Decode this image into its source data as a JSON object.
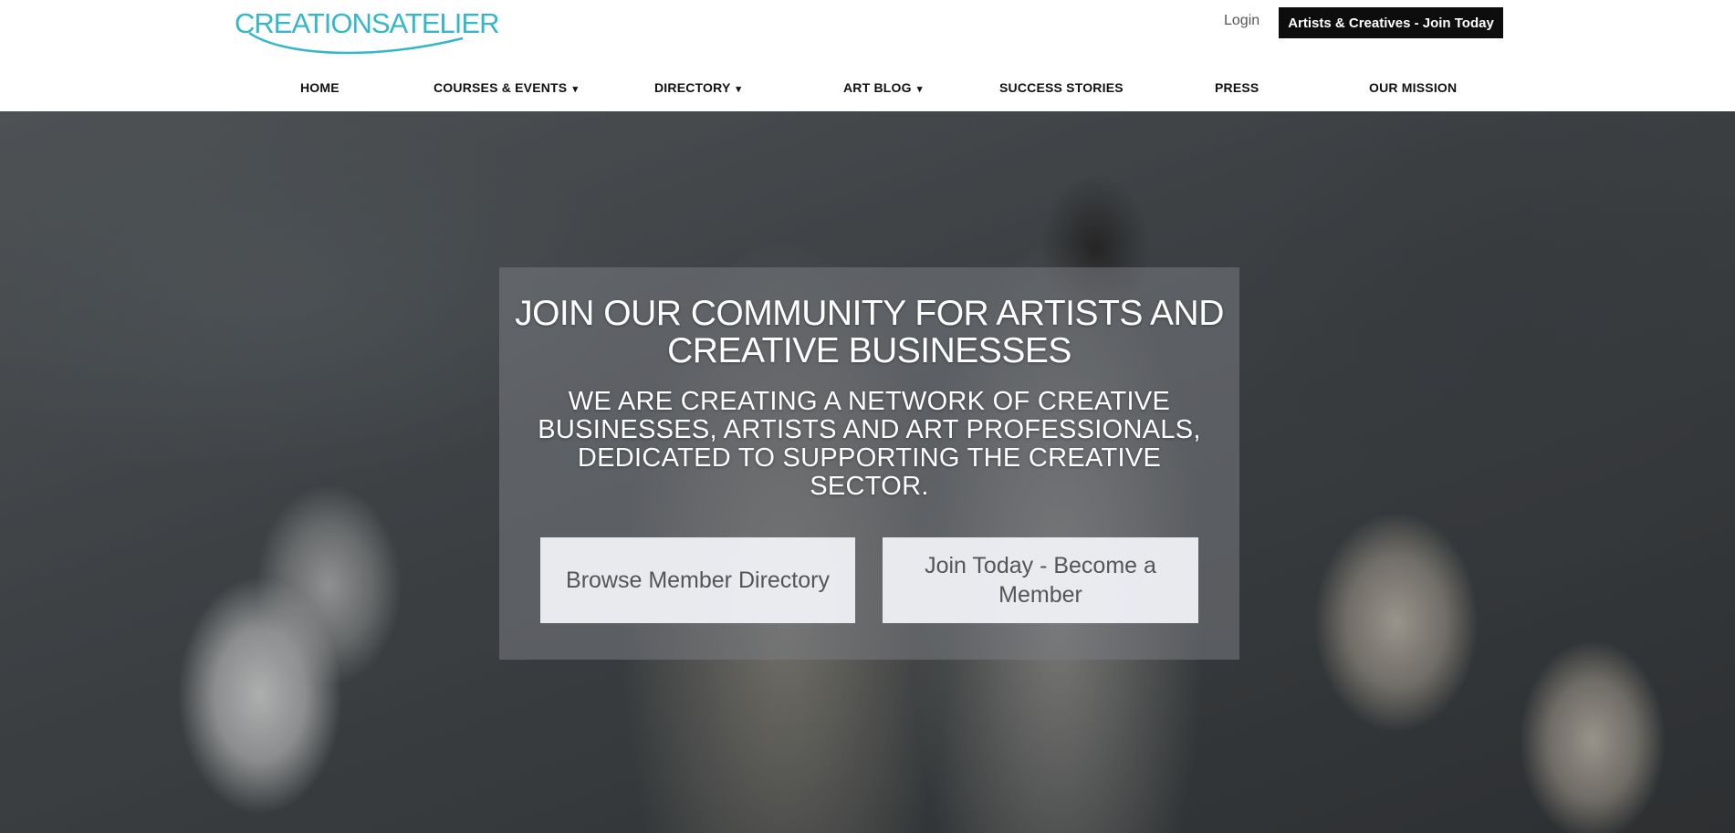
{
  "header": {
    "logo_text": "CREATIONSATELIER",
    "login_label": "Login",
    "cta_label": "Artists & Creatives - Join Today"
  },
  "nav": {
    "items": [
      {
        "label": "HOME",
        "has_dropdown": false
      },
      {
        "label": "COURSES & EVENTS",
        "has_dropdown": true
      },
      {
        "label": "DIRECTORY",
        "has_dropdown": true
      },
      {
        "label": "ART BLOG",
        "has_dropdown": true
      },
      {
        "label": "SUCCESS STORIES",
        "has_dropdown": false
      },
      {
        "label": "PRESS",
        "has_dropdown": false
      },
      {
        "label": "OUR MISSION",
        "has_dropdown": false
      }
    ],
    "caret": "▾"
  },
  "hero": {
    "title": "JOIN OUR COMMUNITY FOR ARTISTS AND CREATIVE BUSINESSES",
    "subtitle": "WE ARE CREATING A NETWORK OF CREATIVE BUSINESSES, ARTISTS AND ART PROFESSIONALS, DEDICATED TO SUPPORTING THE CREATIVE SECTOR.",
    "browse_button": "Browse Member Directory",
    "join_button": "Join Today - Become a Member"
  },
  "colors": {
    "brand": "#35b7c7",
    "cta_background": "#0d0d0d",
    "nav_text": "#111111"
  }
}
